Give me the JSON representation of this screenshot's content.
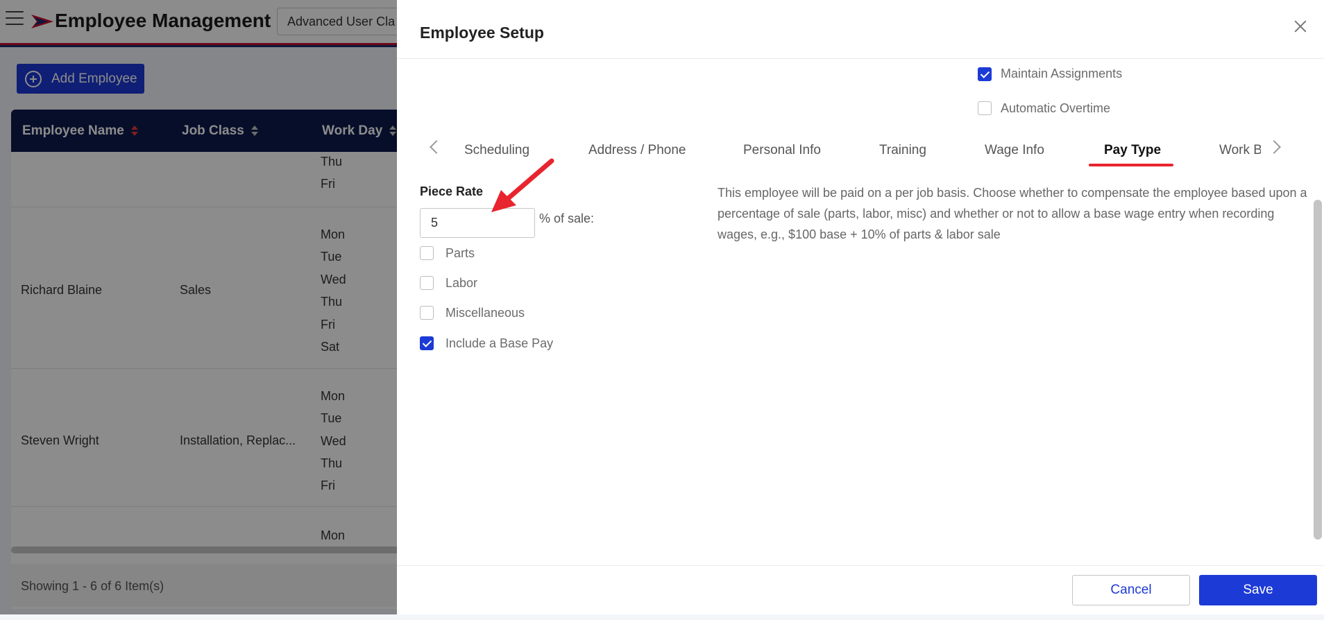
{
  "app": {
    "title": "Employee Management",
    "role_select_value": "Advanced User Cla",
    "add_employee_label": "Add Employee",
    "footer_text": "Showing 1 - 6 of 6 Item(s)"
  },
  "grid": {
    "columns": [
      "Employee Name",
      "Job Class",
      "Work Day"
    ],
    "top_partial_days": [
      "Thu",
      "Fri"
    ],
    "rows": [
      {
        "name": "Richard Blaine",
        "job_class": "Sales",
        "days": [
          "Mon",
          "Tue",
          "Wed",
          "Thu",
          "Fri",
          "Sat"
        ]
      },
      {
        "name": "Steven Wright",
        "job_class": "Installation, Replac...",
        "days": [
          "Mon",
          "Tue",
          "Wed",
          "Thu",
          "Fri"
        ]
      }
    ],
    "bottom_partial_days": [
      "Mon"
    ]
  },
  "drawer": {
    "title": "Employee Setup",
    "options": {
      "maintain_assignments": {
        "label": "Maintain Assignments",
        "checked": true
      },
      "automatic_overtime": {
        "label": "Automatic Overtime",
        "checked": false
      }
    },
    "tabs": [
      {
        "label": "Scheduling",
        "active": false
      },
      {
        "label": "Address / Phone",
        "active": false
      },
      {
        "label": "Personal Info",
        "active": false
      },
      {
        "label": "Training",
        "active": false
      },
      {
        "label": "Wage Info",
        "active": false
      },
      {
        "label": "Pay Type",
        "active": true
      },
      {
        "label": "Work B",
        "active": false
      }
    ],
    "piece_rate": {
      "title": "Piece Rate",
      "value": "5",
      "suffix": "% of sale:",
      "checkboxes": [
        {
          "label": "Parts",
          "checked": false
        },
        {
          "label": "Labor",
          "checked": false
        },
        {
          "label": "Miscellaneous",
          "checked": false
        },
        {
          "label": "Include a Base Pay",
          "checked": true
        }
      ]
    },
    "description": "This employee will be paid on a per job basis. Choose whether to compensate the employee based upon a percentage of sale (parts, labor, misc) and whether or not to allow a base wage entry when recording wages, e.g., $100 base + 10% of parts & labor sale",
    "cancel_label": "Cancel",
    "save_label": "Save"
  },
  "colors": {
    "primary": "#1c3ad6",
    "header_navy": "#0e1b4d",
    "active_tab": "#e8242e",
    "annotation_arrow": "#e8242e"
  }
}
